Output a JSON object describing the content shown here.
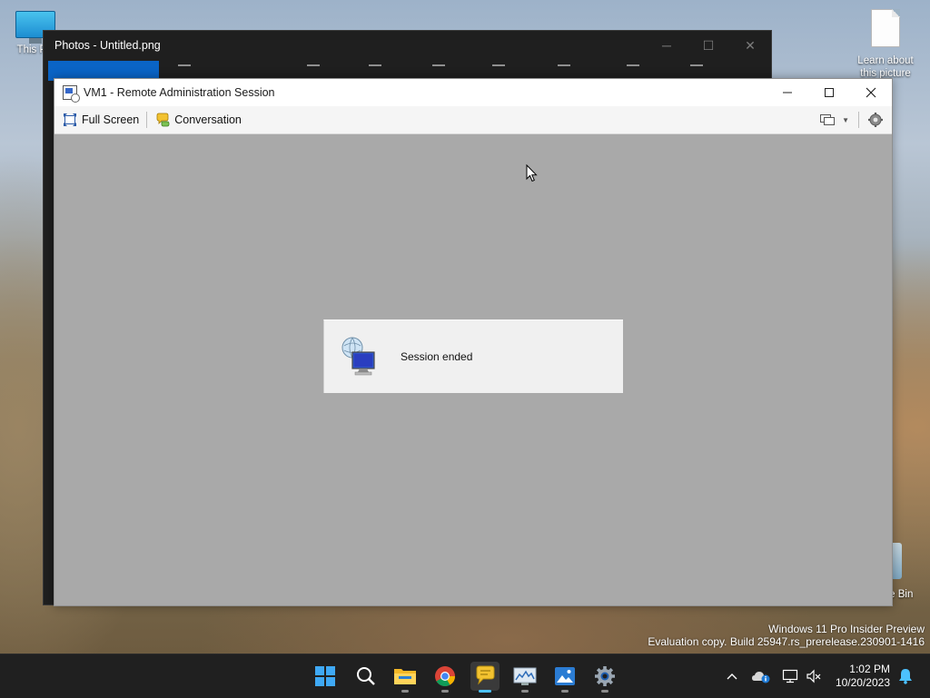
{
  "desktop": {
    "icons": [
      {
        "label": "This PC",
        "icon": "this-pc-icon"
      },
      {
        "label": "Learn about this picture",
        "icon": "document-icon"
      },
      {
        "label": "Recycle Bin",
        "icon": "recycle-bin-icon"
      }
    ],
    "watermark": {
      "line1": "Windows 11 Pro Insider Preview",
      "line2": "Evaluation copy. Build 25947.rs_prerelease.230901-1416"
    }
  },
  "photos_window": {
    "title": "Photos - Untitled.png",
    "controls": {
      "minimize": "─",
      "maximize": "☐",
      "close": "✕"
    }
  },
  "vm_window": {
    "title": "VM1 - Remote Administration Session",
    "toolbar": {
      "full_screen": "Full Screen",
      "conversation": "Conversation"
    },
    "session_message": "Session ended",
    "colors": {
      "screen_bg": "#a9a9a9",
      "message_bg": "#f0f0f0"
    }
  },
  "taskbar": {
    "apps": [
      {
        "name": "start-button",
        "icon": "windows-logo-icon"
      },
      {
        "name": "search-button",
        "icon": "search-icon"
      },
      {
        "name": "file-explorer",
        "icon": "folder-icon"
      },
      {
        "name": "chrome",
        "icon": "chrome-icon"
      },
      {
        "name": "remote-admin-app",
        "icon": "chat-bubble-icon",
        "active": true
      },
      {
        "name": "resource-monitor",
        "icon": "monitor-graph-icon"
      },
      {
        "name": "photos-app",
        "icon": "photos-icon"
      },
      {
        "name": "settings-app",
        "icon": "gear-icon"
      }
    ],
    "tray_icons": [
      "chevron-up-icon",
      "cloud-info-icon",
      "network-icon",
      "volume-muted-icon"
    ],
    "clock": {
      "time": "1:02 PM",
      "date": "10/20/2023"
    },
    "accent_color": "#4cc2ff"
  }
}
